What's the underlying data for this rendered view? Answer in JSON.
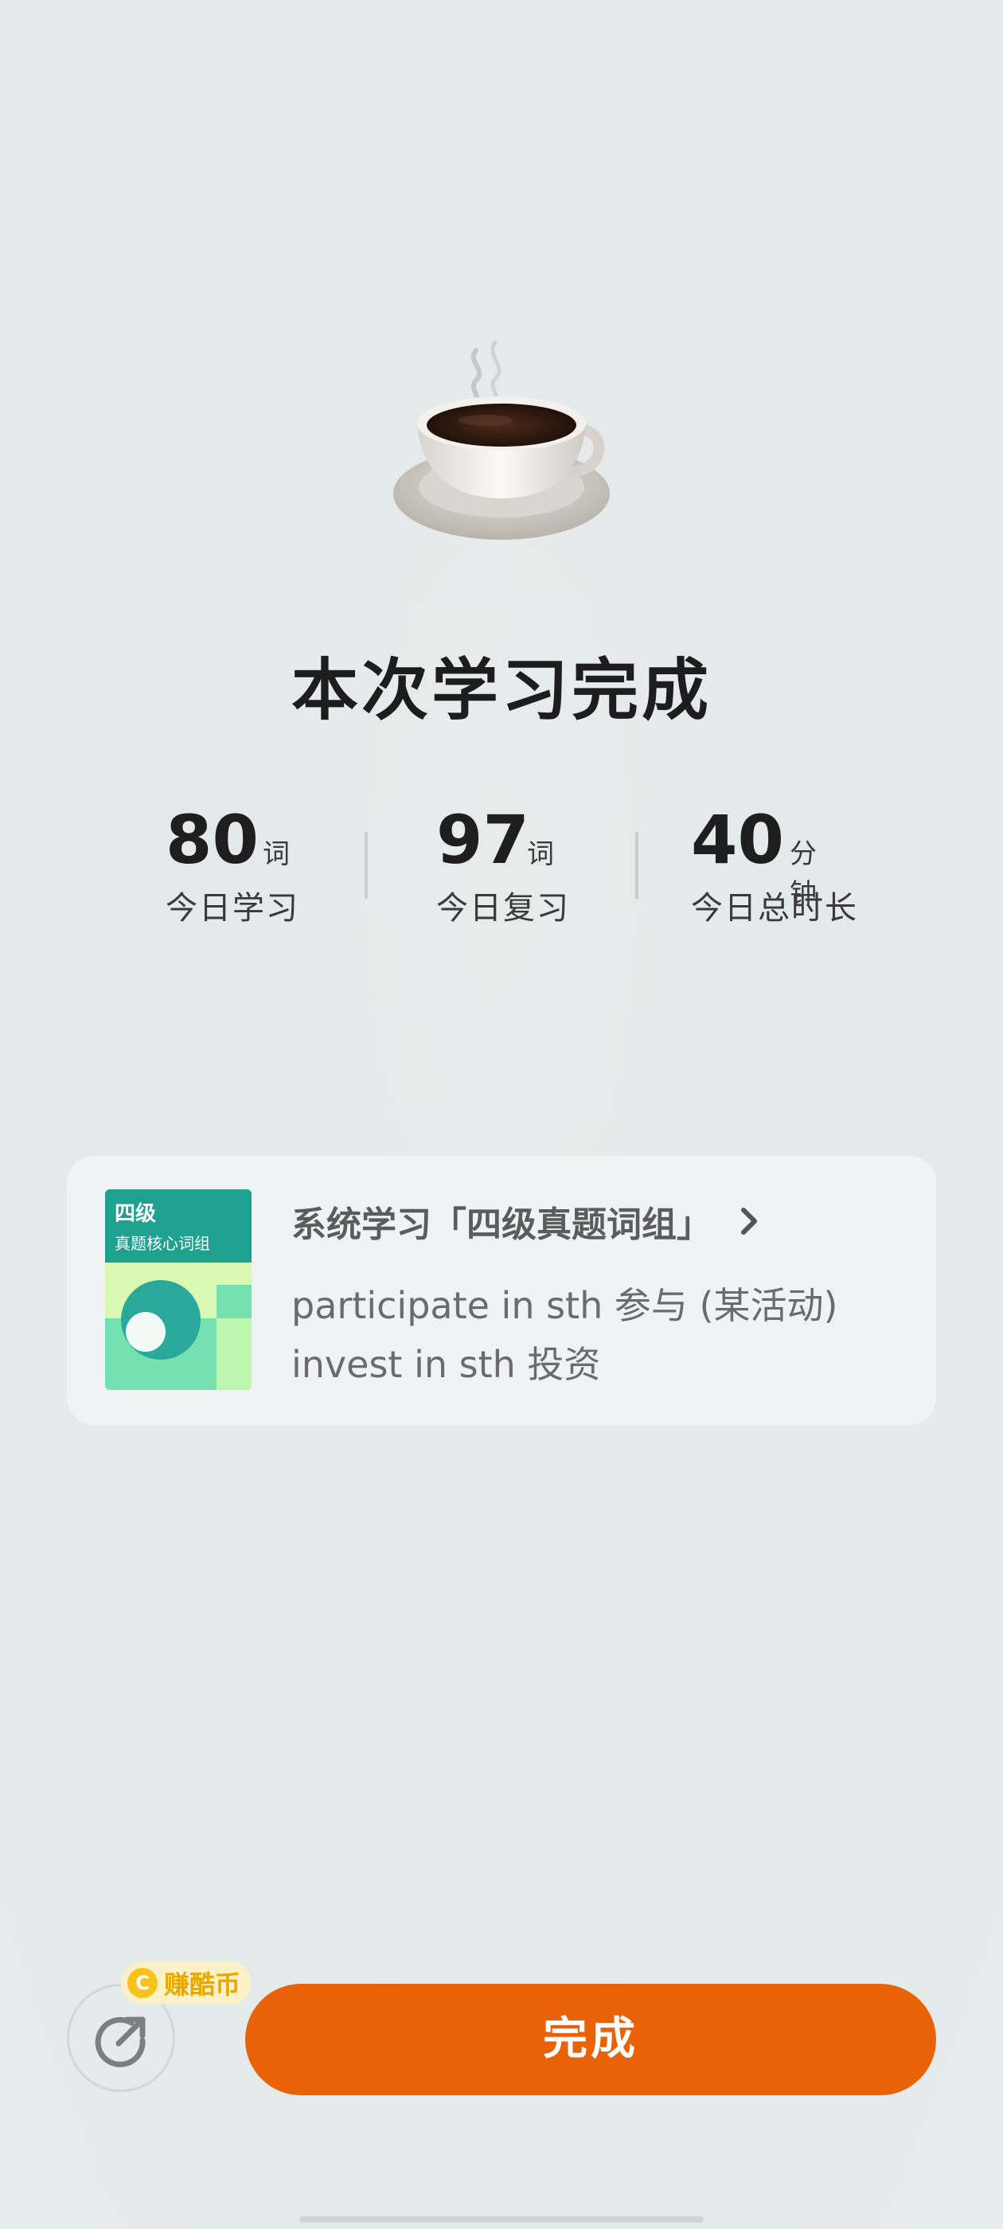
{
  "illustration": {
    "icon": "coffee-cup-icon"
  },
  "title": "本次学习完成",
  "stats": [
    {
      "value": "80",
      "unit": "词",
      "label": "今日学习"
    },
    {
      "value": "97",
      "unit": "词",
      "label": "今日复习"
    },
    {
      "value": "40",
      "unit": "分钟",
      "label": "今日总时长"
    }
  ],
  "book_card": {
    "cover_title": "四级",
    "cover_subtitle": "真题核心词组",
    "heading": "系统学习「四级真题词组」",
    "lines": [
      "participate in sth 参与 (某活动)",
      "invest in sth 投资"
    ]
  },
  "footer": {
    "coin_badge": "赚酷币",
    "coin_icon_text": "C",
    "done_label": "完成"
  },
  "colors": {
    "accent": "#ea6208",
    "coin": "#f7c21a",
    "cover_green": "#1fa18f"
  }
}
